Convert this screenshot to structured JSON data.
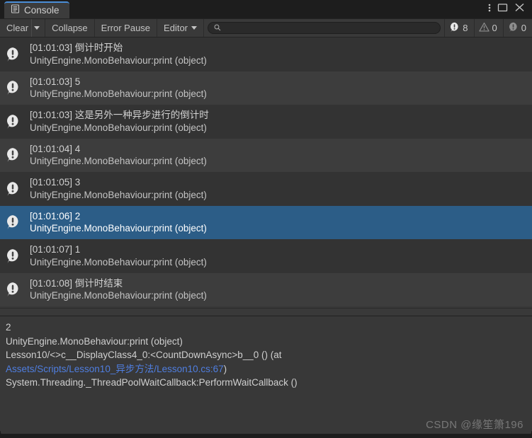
{
  "window": {
    "tab_label": "Console",
    "tab_icon": "console-icon",
    "menu_icon": "kebab-menu-icon",
    "maximize_icon": "maximize-icon",
    "close_icon": "close-icon",
    "accent_color": "#4a8ed8"
  },
  "toolbar": {
    "clear_label": "Clear",
    "clear_dropdown_icon": "chevron-down-icon",
    "collapse_label": "Collapse",
    "error_pause_label": "Error Pause",
    "editor_label": "Editor",
    "editor_dropdown_icon": "chevron-down-icon",
    "search_icon": "search-icon",
    "search_value": "",
    "search_placeholder": "",
    "counters": [
      {
        "name": "log-count",
        "icon": "info-bubble-icon",
        "value": "8"
      },
      {
        "name": "warning-count",
        "icon": "warning-triangle-icon",
        "value": "0"
      },
      {
        "name": "error-count",
        "icon": "error-circle-icon",
        "value": "0"
      }
    ]
  },
  "log_entries": [
    {
      "icon": "info-bubble-icon",
      "message": "[01:01:03] 倒计时开始",
      "stack": "UnityEngine.MonoBehaviour:print (object)",
      "selected": false
    },
    {
      "icon": "info-bubble-icon",
      "message": "[01:01:03] 5",
      "stack": "UnityEngine.MonoBehaviour:print (object)",
      "selected": false
    },
    {
      "icon": "info-bubble-icon",
      "message": "[01:01:03] 这是另外一种异步进行的倒计时",
      "stack": "UnityEngine.MonoBehaviour:print (object)",
      "selected": false
    },
    {
      "icon": "info-bubble-icon",
      "message": "[01:01:04] 4",
      "stack": "UnityEngine.MonoBehaviour:print (object)",
      "selected": false
    },
    {
      "icon": "info-bubble-icon",
      "message": "[01:01:05] 3",
      "stack": "UnityEngine.MonoBehaviour:print (object)",
      "selected": false
    },
    {
      "icon": "info-bubble-icon",
      "message": "[01:01:06] 2",
      "stack": "UnityEngine.MonoBehaviour:print (object)",
      "selected": true
    },
    {
      "icon": "info-bubble-icon",
      "message": "[01:01:07] 1",
      "stack": "UnityEngine.MonoBehaviour:print (object)",
      "selected": false
    },
    {
      "icon": "info-bubble-icon",
      "message": "[01:01:08] 倒计时结束",
      "stack": "UnityEngine.MonoBehaviour:print (object)",
      "selected": false
    }
  ],
  "detail": {
    "line1": "2",
    "line2": "UnityEngine.MonoBehaviour:print (object)",
    "line3": "Lesson10/<>c__DisplayClass4_0:<CountDownAsync>b__0 () (at ",
    "link": "Assets/Scripts/Lesson10_异步方法/Lesson10.cs:67",
    "line4_suffix": ")",
    "line5": "System.Threading._ThreadPoolWaitCallback:PerformWaitCallback ()"
  },
  "watermark": "CSDN @缘笙箫196"
}
